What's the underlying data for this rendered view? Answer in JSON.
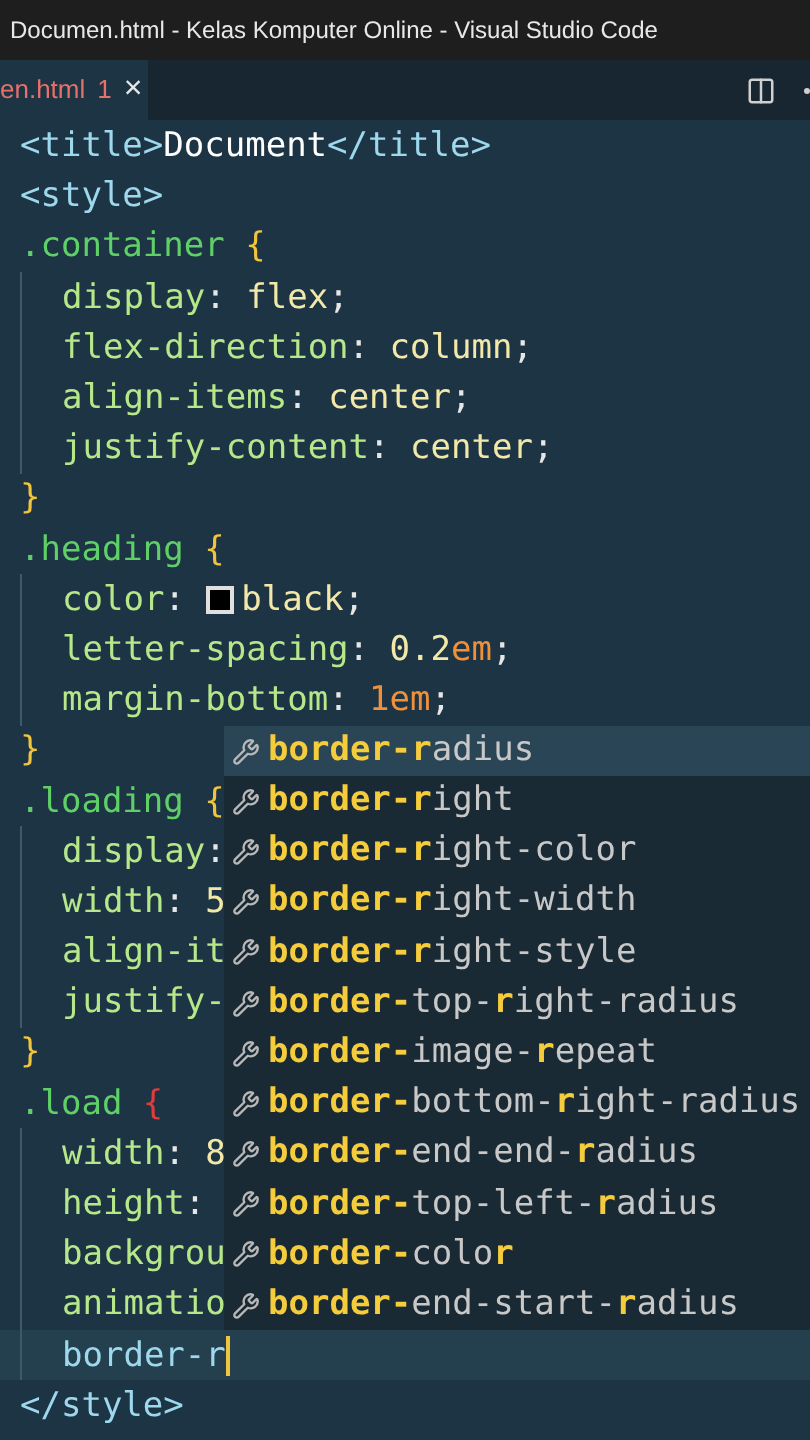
{
  "window": {
    "title": "Documen.html - Kelas Komputer Online - Visual Studio Code"
  },
  "tab": {
    "label": "en.html",
    "problems": "1",
    "close": "×",
    "selected": true
  },
  "editor": {
    "lines": [
      {
        "indented": false,
        "current": false,
        "tokens": [
          {
            "t": "<title>",
            "kind": "tag"
          },
          {
            "t": "Document",
            "kind": "text"
          },
          {
            "t": "</title>",
            "kind": "tag"
          }
        ]
      },
      {
        "indented": false,
        "current": false,
        "tokens": [
          {
            "t": "<style>",
            "kind": "tag"
          }
        ]
      },
      {
        "indented": false,
        "current": false,
        "tokens": [
          {
            "t": ".container",
            "kind": "selector"
          },
          {
            "t": " {",
            "kind": "brace"
          }
        ]
      },
      {
        "indented": true,
        "current": false,
        "tokens": [
          {
            "t": "display",
            "kind": "prop"
          },
          {
            "t": ": ",
            "kind": "punct"
          },
          {
            "t": "flex",
            "kind": "value"
          },
          {
            "t": ";",
            "kind": "punct"
          }
        ]
      },
      {
        "indented": true,
        "current": false,
        "tokens": [
          {
            "t": "flex-direction",
            "kind": "prop"
          },
          {
            "t": ": ",
            "kind": "punct"
          },
          {
            "t": "column",
            "kind": "value"
          },
          {
            "t": ";",
            "kind": "punct"
          }
        ]
      },
      {
        "indented": true,
        "current": false,
        "tokens": [
          {
            "t": "align-items",
            "kind": "prop"
          },
          {
            "t": ": ",
            "kind": "punct"
          },
          {
            "t": "center",
            "kind": "value"
          },
          {
            "t": ";",
            "kind": "punct"
          }
        ]
      },
      {
        "indented": true,
        "current": false,
        "tokens": [
          {
            "t": "justify-content",
            "kind": "prop"
          },
          {
            "t": ": ",
            "kind": "punct"
          },
          {
            "t": "center",
            "kind": "value"
          },
          {
            "t": ";",
            "kind": "punct"
          }
        ]
      },
      {
        "indented": false,
        "current": false,
        "tokens": [
          {
            "t": "}",
            "kind": "brace"
          }
        ]
      },
      {
        "indented": false,
        "current": false,
        "tokens": [
          {
            "t": ".heading",
            "kind": "selector"
          },
          {
            "t": " {",
            "kind": "brace"
          }
        ]
      },
      {
        "indented": true,
        "current": false,
        "tokens": [
          {
            "t": "color",
            "kind": "prop"
          },
          {
            "t": ": ",
            "kind": "punct"
          },
          {
            "kind": "swatch",
            "color": "#000000"
          },
          {
            "t": "black",
            "kind": "value"
          },
          {
            "t": ";",
            "kind": "punct"
          }
        ]
      },
      {
        "indented": true,
        "current": false,
        "tokens": [
          {
            "t": "letter-spacing",
            "kind": "prop"
          },
          {
            "t": ": ",
            "kind": "punct"
          },
          {
            "t": "0.2",
            "kind": "value"
          },
          {
            "t": "em",
            "kind": "unit"
          },
          {
            "t": ";",
            "kind": "punct"
          }
        ]
      },
      {
        "indented": true,
        "current": false,
        "tokens": [
          {
            "t": "margin-bottom",
            "kind": "prop"
          },
          {
            "t": ": ",
            "kind": "punct"
          },
          {
            "t": "1em",
            "kind": "unit"
          },
          {
            "t": ";",
            "kind": "punct"
          }
        ]
      },
      {
        "indented": false,
        "current": false,
        "tokens": [
          {
            "t": "}",
            "kind": "brace"
          }
        ]
      },
      {
        "indented": false,
        "current": false,
        "tokens": [
          {
            "t": ".loading",
            "kind": "selector"
          },
          {
            "t": " {",
            "kind": "brace"
          }
        ]
      },
      {
        "indented": true,
        "current": false,
        "tokens": [
          {
            "t": "display",
            "kind": "prop"
          },
          {
            "t": ":",
            "kind": "punct"
          }
        ]
      },
      {
        "indented": true,
        "current": false,
        "tokens": [
          {
            "t": "width",
            "kind": "prop"
          },
          {
            "t": ": ",
            "kind": "punct"
          },
          {
            "t": "5",
            "kind": "value"
          }
        ]
      },
      {
        "indented": true,
        "current": false,
        "tokens": [
          {
            "t": "align-it",
            "kind": "prop"
          }
        ]
      },
      {
        "indented": true,
        "current": false,
        "tokens": [
          {
            "t": "justify-",
            "kind": "prop"
          }
        ]
      },
      {
        "indented": false,
        "current": false,
        "tokens": [
          {
            "t": "}",
            "kind": "brace"
          }
        ]
      },
      {
        "indented": false,
        "current": false,
        "tokens": [
          {
            "t": ".load",
            "kind": "selector"
          },
          {
            "t": " {",
            "kind": "brace_error"
          }
        ]
      },
      {
        "indented": true,
        "current": false,
        "tokens": [
          {
            "t": "width",
            "kind": "prop"
          },
          {
            "t": ": ",
            "kind": "punct"
          },
          {
            "t": "8",
            "kind": "value"
          }
        ]
      },
      {
        "indented": true,
        "current": false,
        "tokens": [
          {
            "t": "height",
            "kind": "prop"
          },
          {
            "t": ":",
            "kind": "punct"
          }
        ]
      },
      {
        "indented": true,
        "current": false,
        "tokens": [
          {
            "t": "backgrou",
            "kind": "prop"
          }
        ]
      },
      {
        "indented": true,
        "current": false,
        "tokens": [
          {
            "t": "animatio",
            "kind": "prop"
          }
        ]
      },
      {
        "indented": true,
        "current": true,
        "tokens": [
          {
            "t": "border-r",
            "kind": "typing"
          }
        ]
      },
      {
        "indented": false,
        "current": false,
        "tokens": [
          {
            "t": "</style>",
            "kind": "tag"
          }
        ]
      }
    ]
  },
  "suggestions": [
    {
      "selected": true,
      "label": "**border-r**adius"
    },
    {
      "selected": false,
      "label": "**border-r**ight"
    },
    {
      "selected": false,
      "label": "**border-r**ight-color"
    },
    {
      "selected": false,
      "label": "**border-r**ight-width"
    },
    {
      "selected": false,
      "label": "**border-r**ight-style"
    },
    {
      "selected": false,
      "label": "**border-**top-**r**ight-radius"
    },
    {
      "selected": false,
      "label": "**border-**image-**r**epeat"
    },
    {
      "selected": false,
      "label": "**border-**bottom-**r**ight-radius"
    },
    {
      "selected": false,
      "label": "**border-**end-end-**r**adius"
    },
    {
      "selected": false,
      "label": "**border-**top-left-**r**adius"
    },
    {
      "selected": false,
      "label": "**border-**colo**r**"
    },
    {
      "selected": false,
      "label": "**border-**end-start-**r**adius"
    }
  ]
}
